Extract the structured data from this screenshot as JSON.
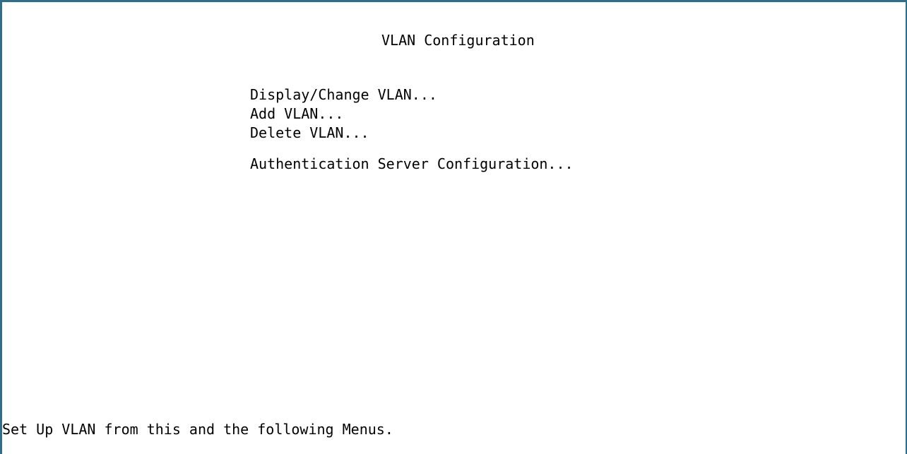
{
  "screen": {
    "title": "VLAN Configuration",
    "menu_items": [
      {
        "label": "Display/Change VLAN..."
      },
      {
        "label": "Add VLAN..."
      },
      {
        "label": "Delete VLAN..."
      },
      {
        "label": "Authentication Server Configuration..."
      }
    ],
    "status_line": "Set Up VLAN from this and the following Menus."
  },
  "colors": {
    "frame": "#2e6e8e",
    "background": "#ffffff",
    "text": "#000000"
  }
}
